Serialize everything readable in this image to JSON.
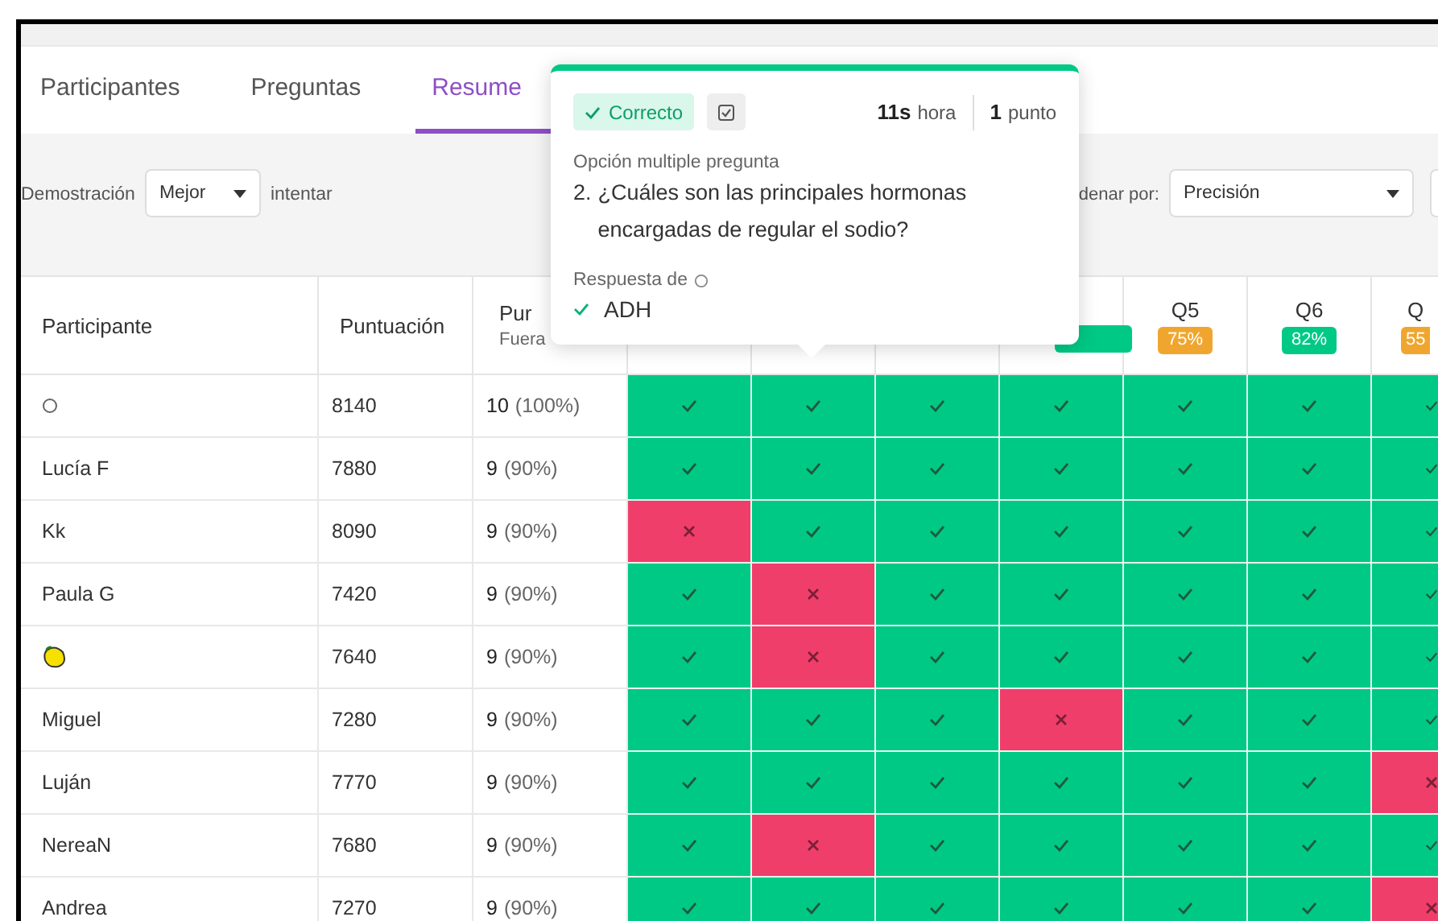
{
  "tabs": [
    {
      "label": "Participantes",
      "selected": false
    },
    {
      "label": "Preguntas",
      "selected": false
    },
    {
      "label": "Resume",
      "selected": true
    }
  ],
  "filters": {
    "show_label": "Demostración",
    "attempt_select": "Mejor",
    "attempt_suffix": "intentar",
    "sort_label": "denar por:",
    "sort_select": "Precisión"
  },
  "table": {
    "columns": [
      "Participante",
      "Puntuación"
    ],
    "points_header": {
      "title": "Pur",
      "subtitle": "Fuera"
    },
    "question_headers": [
      {
        "color": "#00c985"
      },
      {
        "label": "Q5",
        "badge": "75%",
        "color": "#f0a62e"
      },
      {
        "label": "Q6",
        "badge": "82%",
        "color": "#00c985"
      },
      {
        "label": "Q",
        "badge": "55",
        "color": "#f0a62e"
      }
    ],
    "rows": [
      {
        "kind": "smiley",
        "score": "8140",
        "points": "10",
        "percent": "(100%)",
        "answers": [
          true,
          true,
          true,
          true,
          true,
          true,
          true
        ]
      },
      {
        "kind": "text",
        "name": "Lucía F",
        "score": "7880",
        "points": "9",
        "percent": "(90%)",
        "answers": [
          true,
          true,
          true,
          true,
          true,
          true,
          true
        ]
      },
      {
        "kind": "text",
        "name": "Kk",
        "score": "8090",
        "points": "9",
        "percent": "(90%)",
        "answers": [
          false,
          true,
          true,
          true,
          true,
          true,
          true
        ]
      },
      {
        "kind": "text",
        "name": "Paula G",
        "score": "7420",
        "points": "9",
        "percent": "(90%)",
        "answers": [
          true,
          false,
          true,
          true,
          true,
          true,
          true
        ]
      },
      {
        "kind": "lemon",
        "score": "7640",
        "points": "9",
        "percent": "(90%)",
        "answers": [
          true,
          false,
          true,
          true,
          true,
          true,
          true
        ]
      },
      {
        "kind": "text",
        "name": "Miguel",
        "score": "7280",
        "points": "9",
        "percent": "(90%)",
        "answers": [
          true,
          true,
          true,
          false,
          true,
          true,
          true
        ]
      },
      {
        "kind": "text",
        "name": "Luján",
        "score": "7770",
        "points": "9",
        "percent": "(90%)",
        "answers": [
          true,
          true,
          true,
          true,
          true,
          true,
          false
        ]
      },
      {
        "kind": "text",
        "name": "NereaN",
        "score": "7680",
        "points": "9",
        "percent": "(90%)",
        "answers": [
          true,
          false,
          true,
          true,
          true,
          true,
          true
        ]
      },
      {
        "kind": "text",
        "name": "Andrea",
        "score": "7270",
        "points": "9",
        "percent": "(90%)",
        "answers": [
          true,
          true,
          true,
          true,
          true,
          true,
          false
        ]
      }
    ]
  },
  "tooltip": {
    "status": "Correcto",
    "correct": true,
    "time_value": "11s",
    "time_label": "hora",
    "points_value": "1",
    "points_label": "punto",
    "question_type": "Opción multiple pregunta",
    "question_number": "2.",
    "question_text": "¿Cuáles son las principales hormonas encargadas de regular el sodio?",
    "answer_label": "Respuesta de",
    "answer": "ADH"
  }
}
